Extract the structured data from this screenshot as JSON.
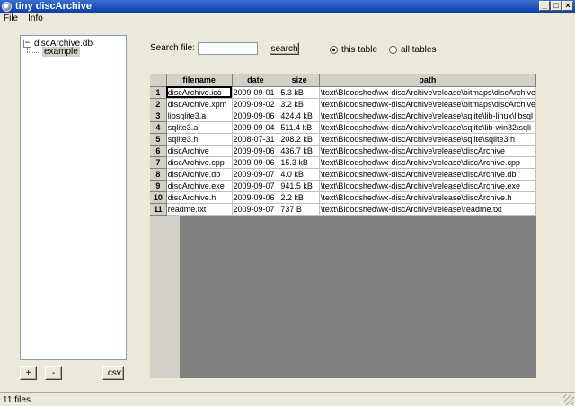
{
  "window": {
    "title": "tiny discArchive",
    "controls": {
      "minimize": "_",
      "maximize": "□",
      "close": "×"
    }
  },
  "menu": [
    "File",
    "Info"
  ],
  "tree": {
    "root": "discArchive.db",
    "expander": "−",
    "children": [
      "example"
    ]
  },
  "buttons": {
    "add": "+",
    "remove": "-",
    "csv": ".csv"
  },
  "search": {
    "label": "Search file:",
    "value": "",
    "placeholder": "",
    "button": "search",
    "scope": [
      {
        "label": "this table",
        "checked": true
      },
      {
        "label": "all tables",
        "checked": false
      }
    ]
  },
  "grid": {
    "columns": [
      "filename",
      "date",
      "size",
      "path"
    ],
    "rows": [
      {
        "n": "1",
        "filename": "discArchive.ico",
        "date": "2009-09-01",
        "size": "5.3 kB",
        "path": "\\text\\Bloodshed\\wx-discArchive\\release\\bitmaps\\discArchive"
      },
      {
        "n": "2",
        "filename": "discArchive.xpm",
        "date": "2009-09-02",
        "size": "3.2 kB",
        "path": "\\text\\Bloodshed\\wx-discArchive\\release\\bitmaps\\discArchive"
      },
      {
        "n": "3",
        "filename": "libsqlite3.a",
        "date": "2009-09-06",
        "size": "424.4 kB",
        "path": "\\text\\Bloodshed\\wx-discArchive\\release\\sqlite\\lib-linux\\libsql"
      },
      {
        "n": "4",
        "filename": "sqlite3.a",
        "date": "2009-09-04",
        "size": "511.4 kB",
        "path": "\\text\\Bloodshed\\wx-discArchive\\release\\sqlite\\lib-win32\\sqli"
      },
      {
        "n": "5",
        "filename": "sqlite3.h",
        "date": "2008-07-31",
        "size": "208.2 kB",
        "path": "\\text\\Bloodshed\\wx-discArchive\\release\\sqlite\\sqlite3.h"
      },
      {
        "n": "6",
        "filename": "discArchive",
        "date": "2009-09-06",
        "size": "436.7 kB",
        "path": "\\text\\Bloodshed\\wx-discArchive\\release\\discArchive"
      },
      {
        "n": "7",
        "filename": "discArchive.cpp",
        "date": "2009-09-06",
        "size": "15.3 kB",
        "path": "\\text\\Bloodshed\\wx-discArchive\\release\\discArchive.cpp"
      },
      {
        "n": "8",
        "filename": "discArchive.db",
        "date": "2009-09-07",
        "size": "4.0 kB",
        "path": "\\text\\Bloodshed\\wx-discArchive\\release\\discArchive.db"
      },
      {
        "n": "9",
        "filename": "discArchive.exe",
        "date": "2009-09-07",
        "size": "941.5 kB",
        "path": "\\text\\Bloodshed\\wx-discArchive\\release\\discArchive.exe"
      },
      {
        "n": "10",
        "filename": "discArchive.h",
        "date": "2009-09-06",
        "size": "2.2 kB",
        "path": "\\text\\Bloodshed\\wx-discArchive\\release\\discArchive.h"
      },
      {
        "n": "11",
        "filename": "readme.txt",
        "date": "2009-09-07",
        "size": "737 B",
        "path": "\\text\\Bloodshed\\wx-discArchive\\release\\readme.txt"
      }
    ]
  },
  "status": {
    "text": "11 files"
  }
}
